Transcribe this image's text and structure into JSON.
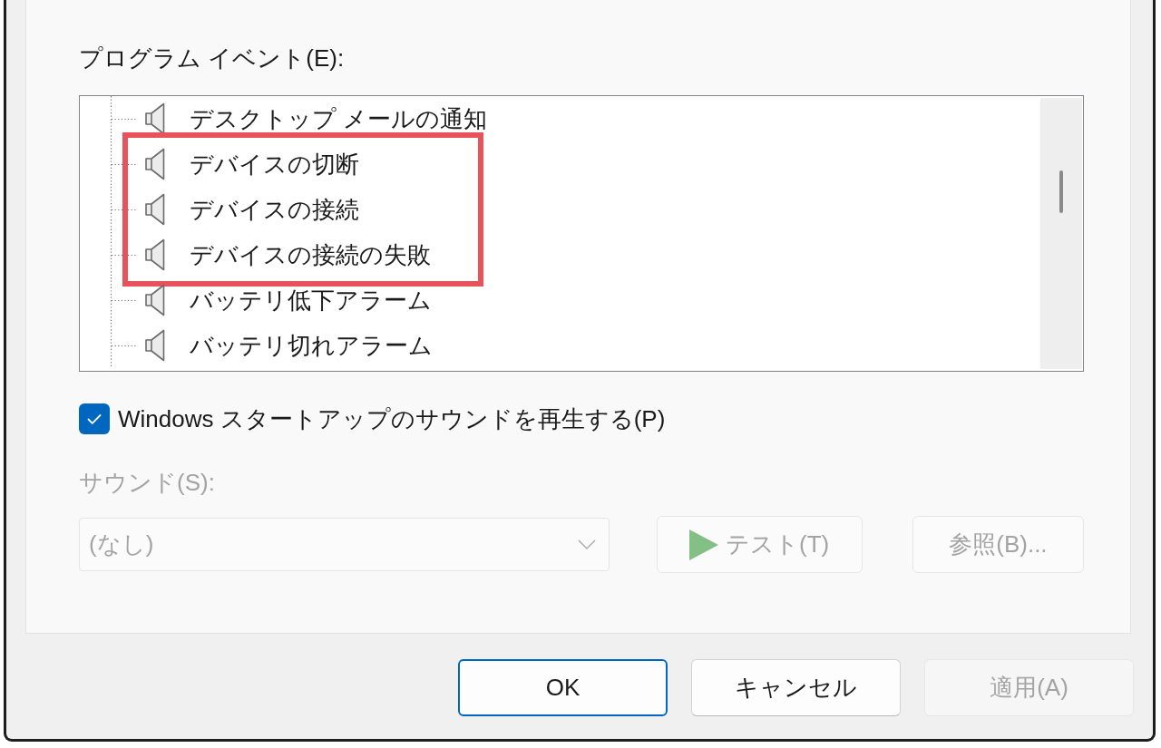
{
  "program_events": {
    "label": "プログラム イベント(E):",
    "groups": [
      {
        "highlighted": false,
        "items": [
          {
            "label": "デスクトップ メールの通知"
          }
        ]
      },
      {
        "highlighted": true,
        "items": [
          {
            "label": "デバイスの切断"
          },
          {
            "label": "デバイスの接続"
          },
          {
            "label": "デバイスの接続の失敗"
          }
        ]
      },
      {
        "highlighted": false,
        "items": [
          {
            "label": "バッテリ低下アラーム"
          },
          {
            "label": "バッテリ切れアラーム"
          }
        ]
      }
    ]
  },
  "startup_sound": {
    "label": "Windows スタートアップのサウンドを再生する(P)",
    "checked": true
  },
  "sound": {
    "label": "サウンド(S):",
    "value": "(なし)",
    "disabled": true
  },
  "sound_buttons": [
    {
      "label": "テスト(T)",
      "kind": "play",
      "disabled": true
    },
    {
      "label": "参照(B)...",
      "kind": "text",
      "disabled": true
    }
  ],
  "dialog_buttons": [
    {
      "label": "OK",
      "default": true,
      "disabled": false
    },
    {
      "label": "キャンセル",
      "default": false,
      "disabled": false
    },
    {
      "label": "適用(A)",
      "default": false,
      "disabled": true
    }
  ]
}
